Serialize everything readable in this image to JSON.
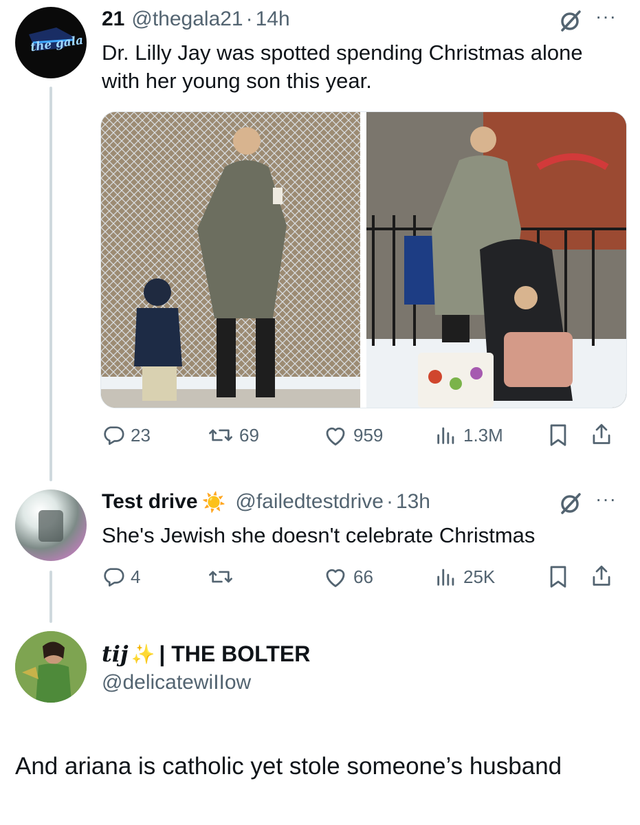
{
  "tweet1": {
    "display_name": "21",
    "handle": "@thegala21",
    "separator": "·",
    "time": "14h",
    "text": "Dr. Lilly Jay was spotted spending Christmas alone with her young son this year.",
    "avatar_text": "the gala",
    "stats": {
      "replies": "23",
      "retweets": "69",
      "likes": "959",
      "views": "1.3M"
    }
  },
  "tweet2": {
    "display_name": "Test drive",
    "emoji": "☀️",
    "handle": "@failedtestdrive",
    "separator": "·",
    "time": "13h",
    "text": "She's Jewish she doesn't celebrate Christmas",
    "stats": {
      "replies": "4",
      "retweets": "",
      "likes": "66",
      "views": "25K"
    }
  },
  "tweet3": {
    "display_name": "tij",
    "emoji": "✨",
    "name_suffix": "| THE BOLTER",
    "handle": "@delicatewiIIow",
    "text": "And ariana is catholic yet stole someone’s husband"
  },
  "icons": {
    "more": "more-icon",
    "grok": "grok-icon",
    "reply": "reply-icon",
    "retweet": "retweet-icon",
    "like": "like-icon",
    "views": "views-icon",
    "bookmark": "bookmark-icon",
    "share": "share-icon"
  },
  "colors": {
    "text": "#0f1419",
    "muted": "#536471",
    "thread_line": "#cfd9de"
  }
}
